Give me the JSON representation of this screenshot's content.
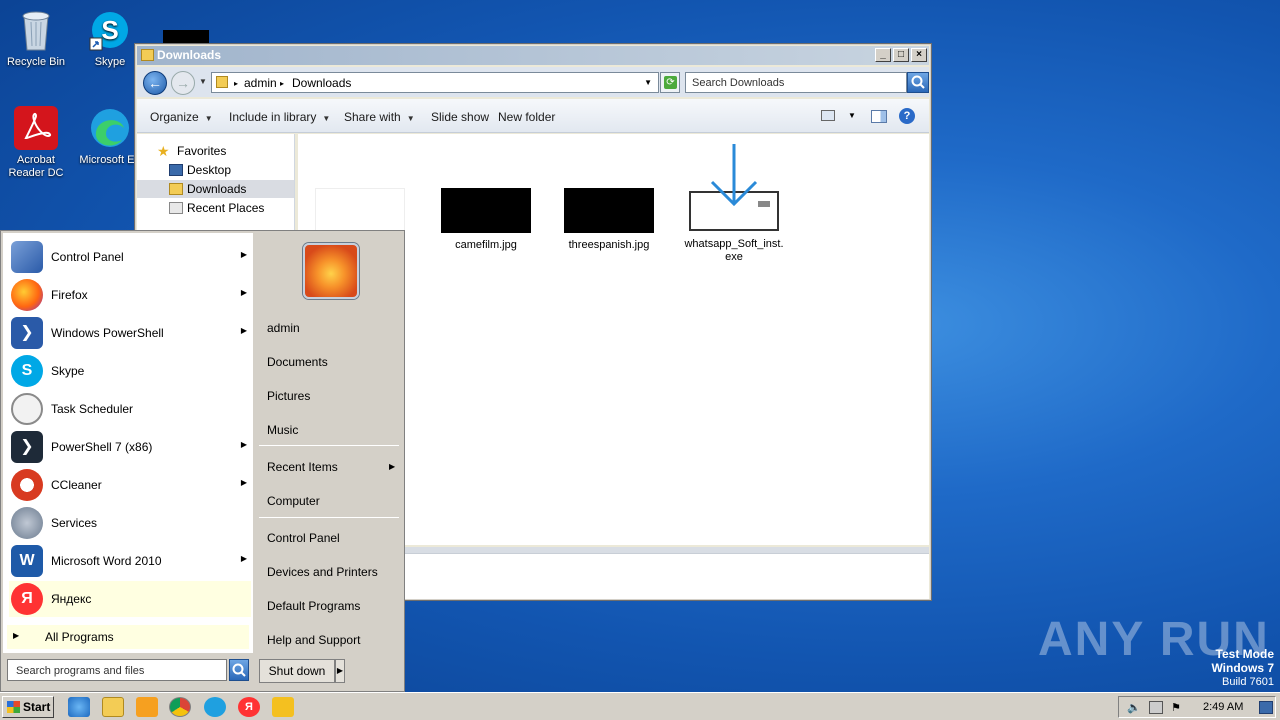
{
  "desktop": {
    "icons": [
      {
        "label": "Recycle Bin"
      },
      {
        "label": "Skype"
      },
      {
        "label": "Acrobat Reader DC"
      },
      {
        "label": "Microsoft Ed"
      }
    ]
  },
  "explorer": {
    "title": "Downloads",
    "breadcrumb": [
      "admin",
      "Downloads"
    ],
    "search_placeholder": "Search Downloads",
    "toolbar": {
      "organize": "Organize",
      "include_in_library": "Include in library",
      "share_with": "Share with",
      "slide_show": "Slide show",
      "new_folder": "New folder"
    },
    "navpane": {
      "favorites": "Favorites",
      "desktop": "Desktop",
      "downloads": "Downloads",
      "recent_places": "Recent Places"
    },
    "files": [
      {
        "name": ""
      },
      {
        "name": "camefilm.jpg"
      },
      {
        "name": "threespanish.jpg"
      },
      {
        "name": "whatsapp_Soft_inst.exe"
      }
    ]
  },
  "start_menu": {
    "programs": [
      {
        "label": "Control Panel",
        "submenu": true,
        "icon": "control-panel-icon"
      },
      {
        "label": "Firefox",
        "submenu": true,
        "icon": "firefox-icon"
      },
      {
        "label": "Windows PowerShell",
        "submenu": true,
        "icon": "powershell-icon"
      },
      {
        "label": "Skype",
        "submenu": false,
        "icon": "skype-icon"
      },
      {
        "label": "Task Scheduler",
        "submenu": false,
        "icon": "clock-icon"
      },
      {
        "label": "PowerShell 7 (x86)",
        "submenu": true,
        "icon": "powershell7-icon"
      },
      {
        "label": "CCleaner",
        "submenu": true,
        "icon": "ccleaner-icon"
      },
      {
        "label": "Services",
        "submenu": false,
        "icon": "gears-icon"
      },
      {
        "label": "Microsoft Word 2010",
        "submenu": true,
        "icon": "word-icon"
      },
      {
        "label": "Яндекс",
        "submenu": false,
        "icon": "yandex-icon"
      }
    ],
    "all_programs": "All Programs",
    "search_placeholder": "Search programs and files",
    "right": {
      "user": "admin",
      "documents": "Documents",
      "pictures": "Pictures",
      "music": "Music",
      "recent_items": "Recent Items",
      "computer": "Computer",
      "control_panel": "Control Panel",
      "devices_printers": "Devices and Printers",
      "default_programs": "Default Programs",
      "help_support": "Help and Support"
    },
    "shutdown": "Shut down"
  },
  "taskbar": {
    "start": "Start",
    "clock": "2:49 AM"
  },
  "watermark": "ANY RUN",
  "test_mode": {
    "line1": "Test Mode",
    "line2": "Windows 7",
    "line3": "Build 7601"
  },
  "colors": {
    "desktop_bg": "#1f6ac8",
    "start_highlight": "#ffffe1",
    "chrome": "#d4d0c8"
  }
}
